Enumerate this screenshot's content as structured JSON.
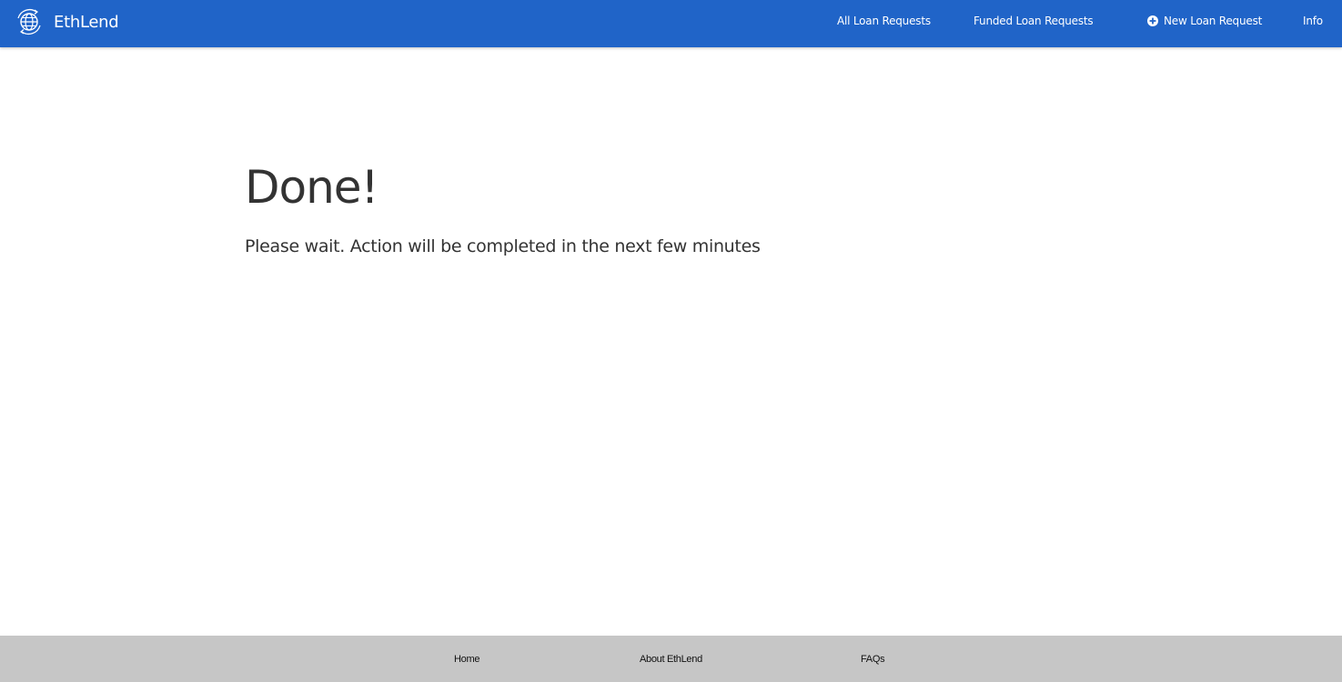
{
  "header": {
    "brand_name": "EthLend",
    "brand_icon": "globe-icon",
    "nav": {
      "all_loans": "All Loan Requests",
      "funded_loans": "Funded Loan Requests",
      "new_loan": "New Loan Request",
      "new_loan_icon": "plus-circle-icon",
      "info": "Info"
    }
  },
  "main": {
    "title": "Done!",
    "message": "Please wait. Action will be completed in the next few minutes"
  },
  "footer": {
    "home": "Home",
    "about": "About EthLend",
    "faqs": "FAQs"
  },
  "colors": {
    "navbar_bg": "#2064c8",
    "footer_bg": "#c6c6c6",
    "text": "#333333"
  }
}
